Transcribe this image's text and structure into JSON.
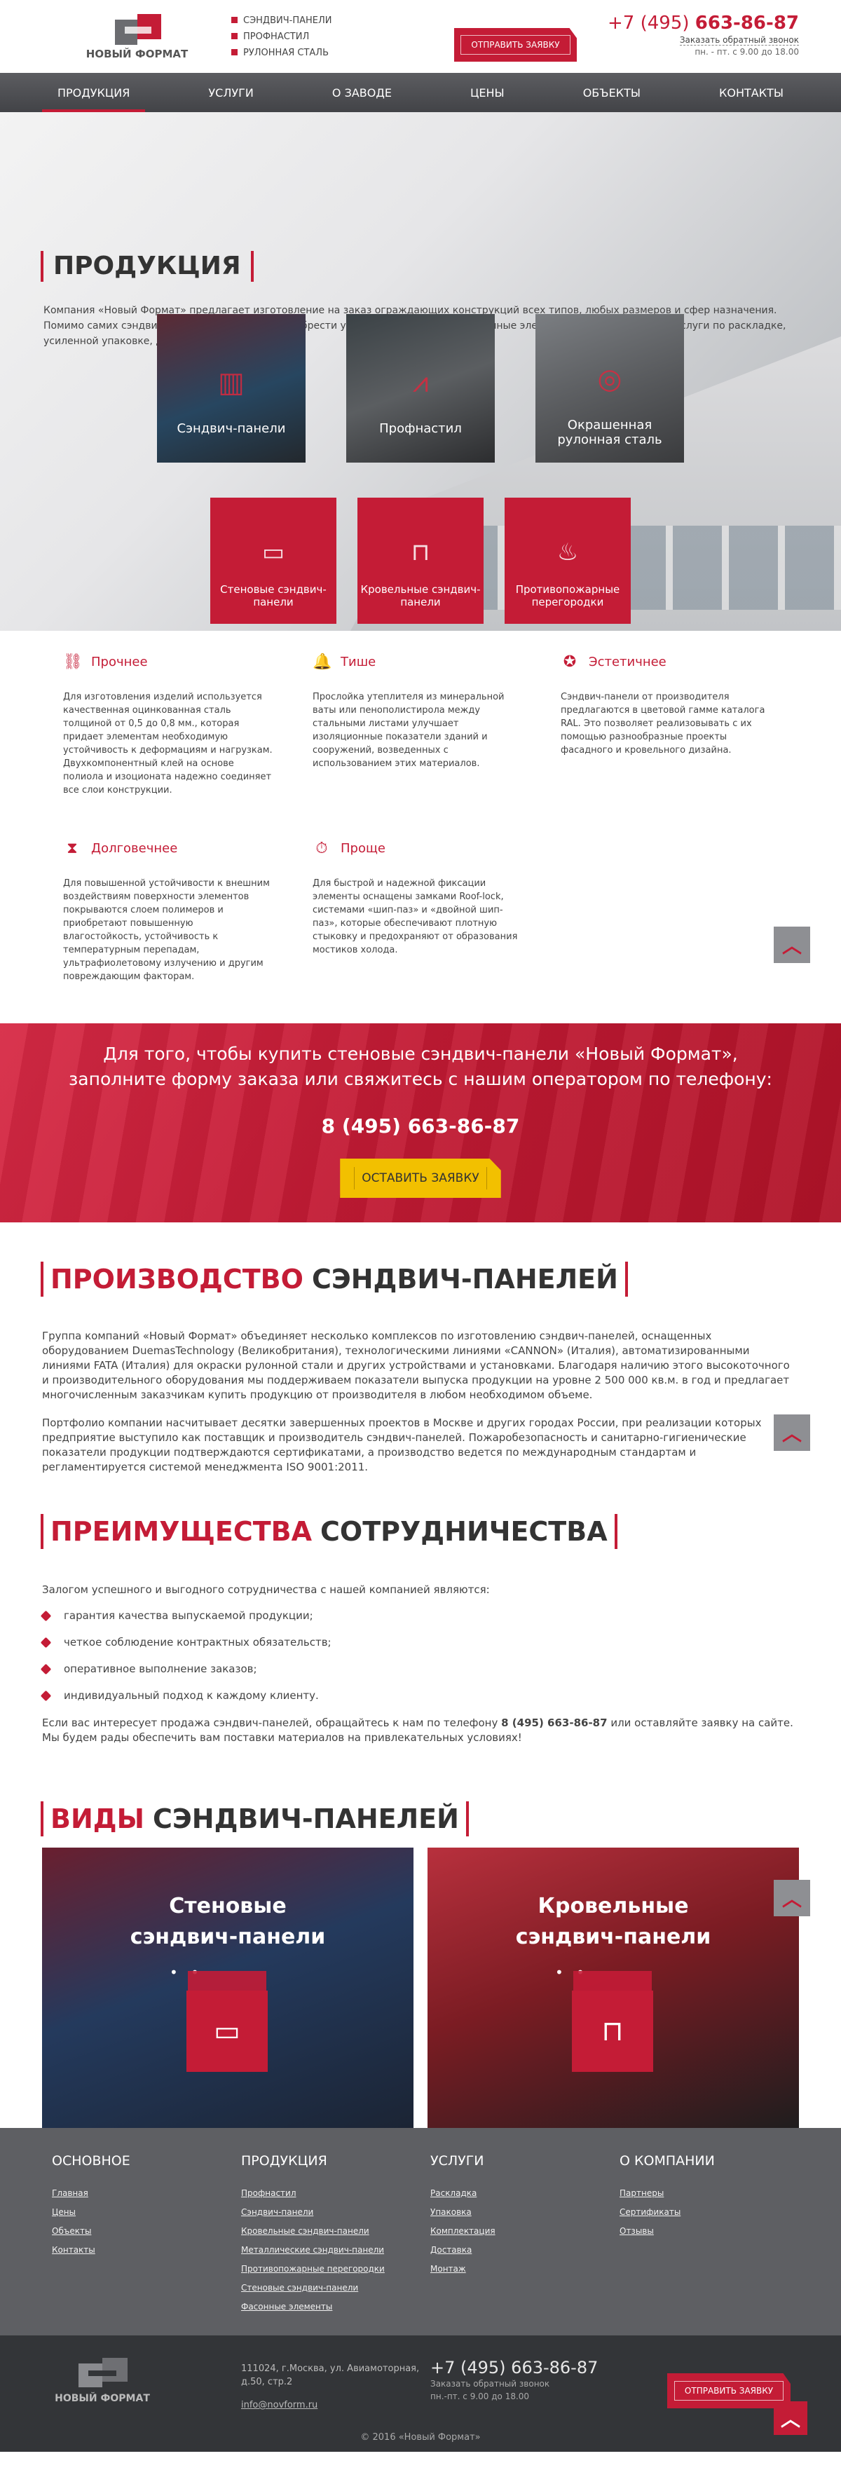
{
  "header": {
    "logo_text": "НОВЫЙ ФОРМАТ",
    "top_links": [
      "СЭНДВИЧ-ПАНЕЛИ",
      "ПРОФНАСТИЛ",
      "РУЛОННАЯ СТАЛЬ"
    ],
    "cta_label": "ОТПРАВИТЬ ЗАЯВКУ",
    "phone_prefix": "+7 (495) ",
    "phone_number": "663-86-87",
    "callback_label": "Заказать обратный звонок",
    "hours": "пн. - пт. с 9.00 до 18.00"
  },
  "nav": {
    "items": [
      "ПРОДУКЦИЯ",
      "УСЛУГИ",
      "О ЗАВОДЕ",
      "ЦЕНЫ",
      "ОБЪЕКТЫ",
      "КОНТАКТЫ"
    ]
  },
  "hero": {
    "title": "ПРОДУКЦИЯ",
    "text": "Компания «Новый Формат» предлагает изготовление на заказ ограждающих конструкций всех типов, любых размеров и сфер назначения. Помимо самих сэндвич-панелей, вы можете приобрести у нас все необходимые фасонные элементы и дополнительные услуги по раскладке, усиленной упаковке, доставке и монтажу СП.",
    "tiles": [
      "Сэндвич-панели",
      "Профнастил",
      "Окрашенная рулонная сталь"
    ],
    "red_tiles": [
      "Стеновые сэндвич-панели",
      "Кровельные сэндвич-панели",
      "Противопожарные перегородки"
    ]
  },
  "features": [
    {
      "title": "Прочнее",
      "text": "Для изготовления изделий используется качественная оцинкованная сталь толщиной от 0,5 до 0,8 мм., которая придает элементам необходимую устойчивость к деформациям и нагрузкам. Двухкомпонентный клей на основе полиола и изоционата надежно соединяет все слои конструкции."
    },
    {
      "title": "Тише",
      "text": "Прослойка утеплителя из минеральной ваты или пенополистирола между стальными листами улучшает изоляционные показатели зданий и сооружений, возведенных с использованием этих материалов."
    },
    {
      "title": "Эстетичнее",
      "text": "Сэндвич-панели от производителя предлагаются в цветовой гамме каталога RAL. Это позволяет реализовывать с их помощью разнообразные проекты фасадного и кровельного дизайна."
    },
    {
      "title": "Долговечнее",
      "text": "Для повышенной устойчивости к внешним воздействиям поверхности элементов покрываются слоем полимеров и приобретают повышенную влагостойкость, устойчивость к температурным перепадам, ультрафиолетовому излучению и другим повреждающим факторам."
    },
    {
      "title": "Проще",
      "text": "Для быстрой и надежной фиксации элементы оснащены замками Roof-lock, системами «шип-паз» и «двойной шип-паз», которые обеспечивают плотную стыковку и предохраняют от образования мостиков холода."
    }
  ],
  "callout": {
    "line1": "Для того, чтобы купить стеновые сэндвич-панели «Новый Формат»,",
    "line2": "заполните форму заказа или свяжитесь с нашим оператором по телефону:",
    "phone": "8 (495) 663-86-87",
    "button": "ОСТАВИТЬ ЗАЯВКУ"
  },
  "production": {
    "title_accent": "ПРОИЗВОДСТВО",
    "title_rest": "СЭНДВИЧ-ПАНЕЛЕЙ",
    "p1": "Группа компаний «Новый Формат» объединяет несколько комплексов по изготовлению сэндвич-панелей, оснащенных оборудованием DuemasTechnology (Великобритания), технологическими линиями «CANNON» (Италия), автоматизированными линиями FATA (Италия) для окраски рулонной стали и других устройствами и установками. Благодаря наличию этого высокоточного и производительного оборудования мы поддерживаем показатели выпуска продукции на уровне 2 500 000 кв.м. в год и предлагает многочисленным заказчикам купить продукцию от производителя в любом необходимом объеме.",
    "p2": "Портфолио компании насчитывает десятки завершенных проектов в Москве и других городах России, при реализации которых предприятие выступило как поставщик и производитель сэндвич-панелей. Пожаробезопасность и санитарно-гигиенические показатели продукции подтверждаются сертификатами, а производство ведется по международным стандартам и регламентируется системой менеджмента ISO 9001:2011."
  },
  "advantages": {
    "title_accent": "ПРЕИМУЩЕСТВА",
    "title_rest": "СОТРУДНИЧЕСТВА",
    "intro": "Залогом успешного и выгодного сотрудничества с нашей компанией являются:",
    "items": [
      "гарантия качества выпускаемой продукции;",
      "четкое соблюдение контрактных обязательств;",
      "оперативное выполнение заказов;",
      "индивидуальный подход к каждому клиенту."
    ],
    "outro_before": "Если вас интересует продажа сэндвич-панелей, обращайтесь к нам по телефону ",
    "outro_phone": "8 (495) 663-86-87",
    "outro_after": " или оставляйте заявку на сайте. Мы будем рады обеспечить вам поставки материалов на привлекательных условиях!"
  },
  "types": {
    "title_accent": "ВИДЫ",
    "title_rest": "СЭНДВИЧ-ПАНЕЛЕЙ",
    "cards": [
      {
        "line1": "Стеновые",
        "line2": "сэндвич-панели"
      },
      {
        "line1": "Кровельные",
        "line2": "сэндвич-панели"
      }
    ]
  },
  "footer": {
    "columns": [
      {
        "title": "ОСНОВНОЕ",
        "links": [
          "Главная",
          "Цены",
          "Объекты",
          "Контакты"
        ]
      },
      {
        "title": "ПРОДУКЦИЯ",
        "links": [
          "Профнастил",
          "Сэндвич-панели",
          "Кровельные сэндвич-панели",
          "Металлические сэндвич-панели",
          "Противопожарные перегородки",
          "Стеновые сэндвич-панели",
          "Фасонные элементы"
        ]
      },
      {
        "title": "УСЛУГИ",
        "links": [
          "Раскладка",
          "Упаковка",
          "Комплектация",
          "Доставка",
          "Монтаж"
        ]
      },
      {
        "title": "О КОМПАНИИ",
        "links": [
          "Партнеры",
          "Сертификаты",
          "Отзывы"
        ]
      }
    ],
    "logo_text": "НОВЫЙ ФОРМАТ",
    "address": "111024, г.Москва, ул. Авиамоторная,",
    "address2": "д.50, стр.2",
    "email": "info@novform.ru",
    "phone": "+7 (495) 663-86-87",
    "callback": "Заказать обратный звонок",
    "hours": "пн.-пт. с 9.00 до 18.00",
    "cta": "ОТПРАВИТЬ ЗАЯВКУ",
    "copyright": "© 2016 «Новый Формат»"
  },
  "colors": {
    "accent": "#c41c36",
    "nav": "#4e4f53",
    "footer": "#5e5f63",
    "yellow": "#f2c000"
  }
}
